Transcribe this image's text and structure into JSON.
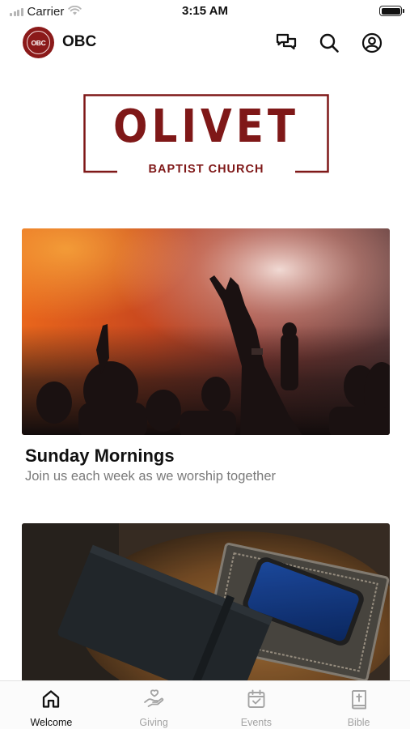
{
  "status_bar": {
    "carrier": "Carrier",
    "time": "3:15 AM"
  },
  "header": {
    "logo_text": "OBC",
    "title": "OBC"
  },
  "church_logo": {
    "name": "OLIVET",
    "subtitle": "BAPTIST CHURCH"
  },
  "cards": [
    {
      "title": "Sunday Mornings",
      "subtitle": "Join us each week as we worship together"
    },
    {
      "title": "",
      "subtitle": ""
    }
  ],
  "tabs": [
    {
      "label": "Welcome",
      "icon": "home-icon",
      "active": true
    },
    {
      "label": "Giving",
      "icon": "giving-icon",
      "active": false
    },
    {
      "label": "Events",
      "icon": "calendar-icon",
      "active": false
    },
    {
      "label": "Bible",
      "icon": "bible-icon",
      "active": false
    }
  ],
  "colors": {
    "brand": "#7f1818",
    "active_tab": "#111111",
    "inactive_tab": "#a3a3a3"
  }
}
